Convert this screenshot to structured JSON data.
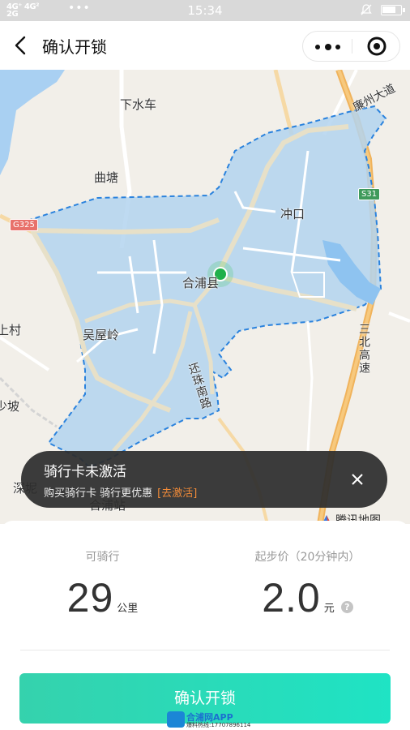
{
  "status_bar": {
    "network": "4G⁺ 4G²\n2G",
    "more": "•••",
    "time": "15:34"
  },
  "nav": {
    "title": "确认开锁"
  },
  "map": {
    "labels": {
      "xiashuiche": "下水车",
      "qutang": "曲塘",
      "chongkou": "冲口",
      "hepu": "合浦县",
      "wuwuling": "吴屋岭",
      "shangcun": "上村",
      "po": "少坡",
      "shenni": "深坭",
      "hepu_station": "合浦站",
      "lianzhou_road": "廉州大道",
      "sanbei_highway": "三北高速",
      "huanzhu_road": "还珠南路"
    },
    "badges": {
      "g325": "G325",
      "s31": "S31"
    },
    "attribution": "腾讯地图"
  },
  "banner": {
    "title": "骑行卡未激活",
    "subtitle": "购买骑行卡 骑行更优惠",
    "link": "[去激活]"
  },
  "stats": {
    "range": {
      "label": "可骑行",
      "value": "29",
      "unit": "公里"
    },
    "price": {
      "label": "起步价（20分钟内）",
      "value": "2.0",
      "unit": "元",
      "help": "?"
    }
  },
  "confirm_button": "确认开锁",
  "watermark": {
    "name": "合浦网APP",
    "hotline": "爆料热线:17707896114"
  }
}
